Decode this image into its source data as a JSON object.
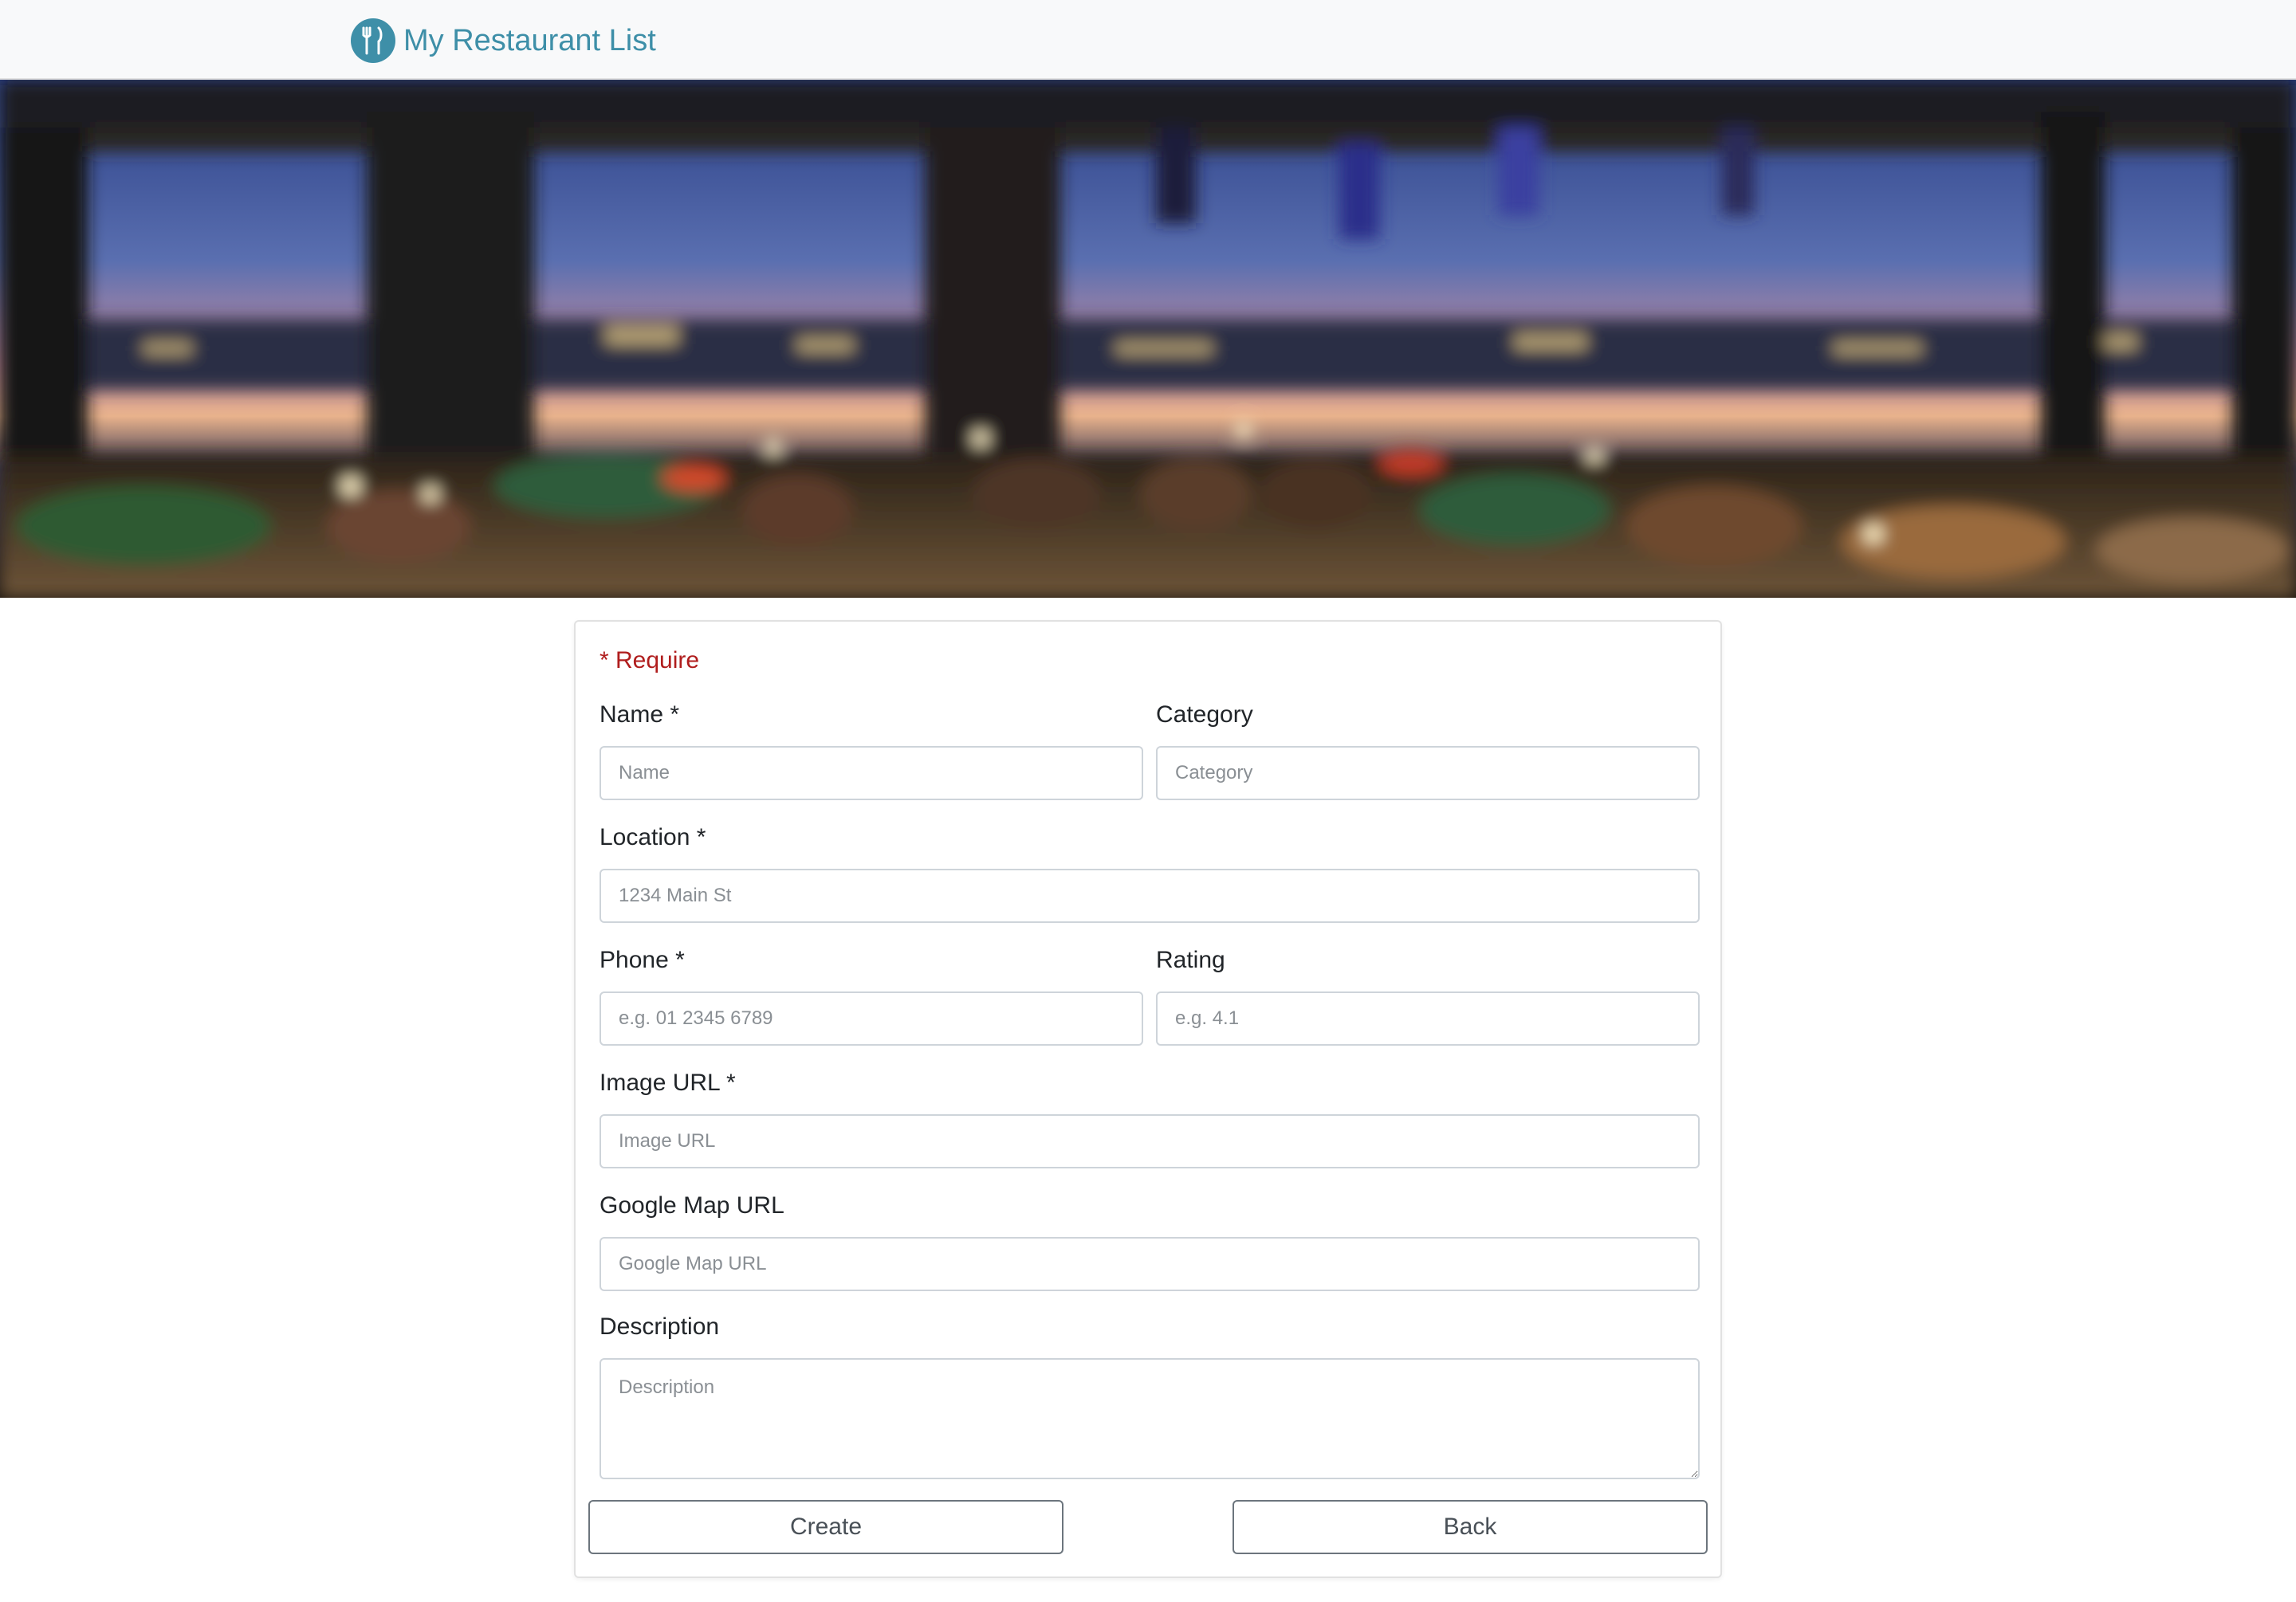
{
  "navbar": {
    "brand_text": "My Restaurant List",
    "brand_icon": "utensils-icon",
    "brand_color": "#3e8fa8"
  },
  "banner": {
    "image_alt": "blurred restaurant interior with city skyline at sunset"
  },
  "form": {
    "require_note": "* Require",
    "require_color": "#b01d1d",
    "fields": {
      "name": {
        "label": "Name *",
        "placeholder": "Name",
        "value": ""
      },
      "category": {
        "label": "Category",
        "placeholder": "Category",
        "value": ""
      },
      "location": {
        "label": "Location *",
        "placeholder": "1234 Main St",
        "value": ""
      },
      "phone": {
        "label": "Phone *",
        "placeholder": "e.g. 01 2345 6789",
        "value": ""
      },
      "rating": {
        "label": "Rating",
        "placeholder": "e.g. 4.1",
        "value": ""
      },
      "image_url": {
        "label": "Image URL *",
        "placeholder": "Image URL",
        "value": ""
      },
      "google_map_url": {
        "label": "Google Map URL",
        "placeholder": "Google Map URL",
        "value": ""
      },
      "description": {
        "label": "Description",
        "placeholder": "Description",
        "value": ""
      }
    },
    "buttons": {
      "create": "Create",
      "back": "Back"
    }
  }
}
